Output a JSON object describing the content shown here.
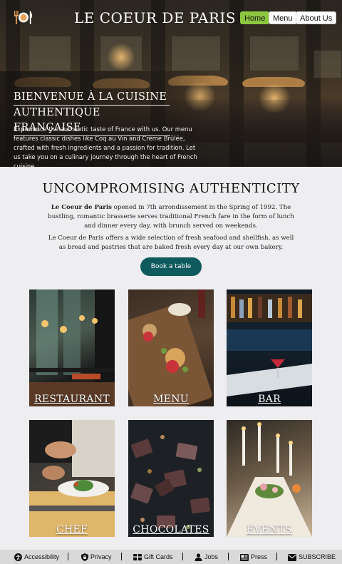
{
  "header": {
    "brand": "LE COEUR DE PARIS",
    "nav": [
      {
        "label": "Home",
        "active": true
      },
      {
        "label": "Menu",
        "active": false
      },
      {
        "label": "About Us",
        "active": false
      }
    ],
    "logo_icon": "fork-plate-knife-icon"
  },
  "hero": {
    "title_line1": "BIENVENUE À LA CUISINE",
    "title_line2": "AUTHENTIQUE FRANÇAISE",
    "description": "Experience the authentic taste of France with us. Our menu features classic dishes like Coq au Vin and Crème Brûlée, crafted with fresh ingredients and a passion for tradition. Let us take you on a culinary journey through the heart of French cuisine."
  },
  "main": {
    "title": "UNCOMPROMISING AUTHENTICITY",
    "para1_bold": "Le Coeur de Paris",
    "para1_rest": " opened in 7th arrondissement in the Spring of 1992. The bustling, romantic brasserie serves traditional French fare in the form of lunch and dinner every day, with brunch served on weekends.",
    "para2": "Le Coeur de Paris offers a wide selection of fresh seafood and shellfish, as well as bread and pastries that are baked fresh every day at our own bakery.",
    "cta": "Book a table"
  },
  "tiles": [
    {
      "label": "RESTAURANT"
    },
    {
      "label": "MENU"
    },
    {
      "label": "BAR"
    },
    {
      "label": "CHEF"
    },
    {
      "label": "CHOCOLATES"
    },
    {
      "label": "EVENTS"
    }
  ],
  "footer": {
    "items": [
      {
        "label": "Accessibility",
        "icon": "accessibility-icon"
      },
      {
        "label": "Privacy",
        "icon": "lock-shield-icon"
      },
      {
        "label": "Gift Cards",
        "icon": "gift-card-icon"
      },
      {
        "label": "Jobs",
        "icon": "person-icon"
      },
      {
        "label": "Press",
        "icon": "newspaper-icon"
      },
      {
        "label": "SUBSCRIBE",
        "icon": "envelope-icon"
      }
    ]
  },
  "colors": {
    "accent_green": "#8dc63f",
    "cta_teal": "#0f5a5d",
    "page_bg": "#eeedef",
    "footer_bg": "#d9d9d9"
  }
}
